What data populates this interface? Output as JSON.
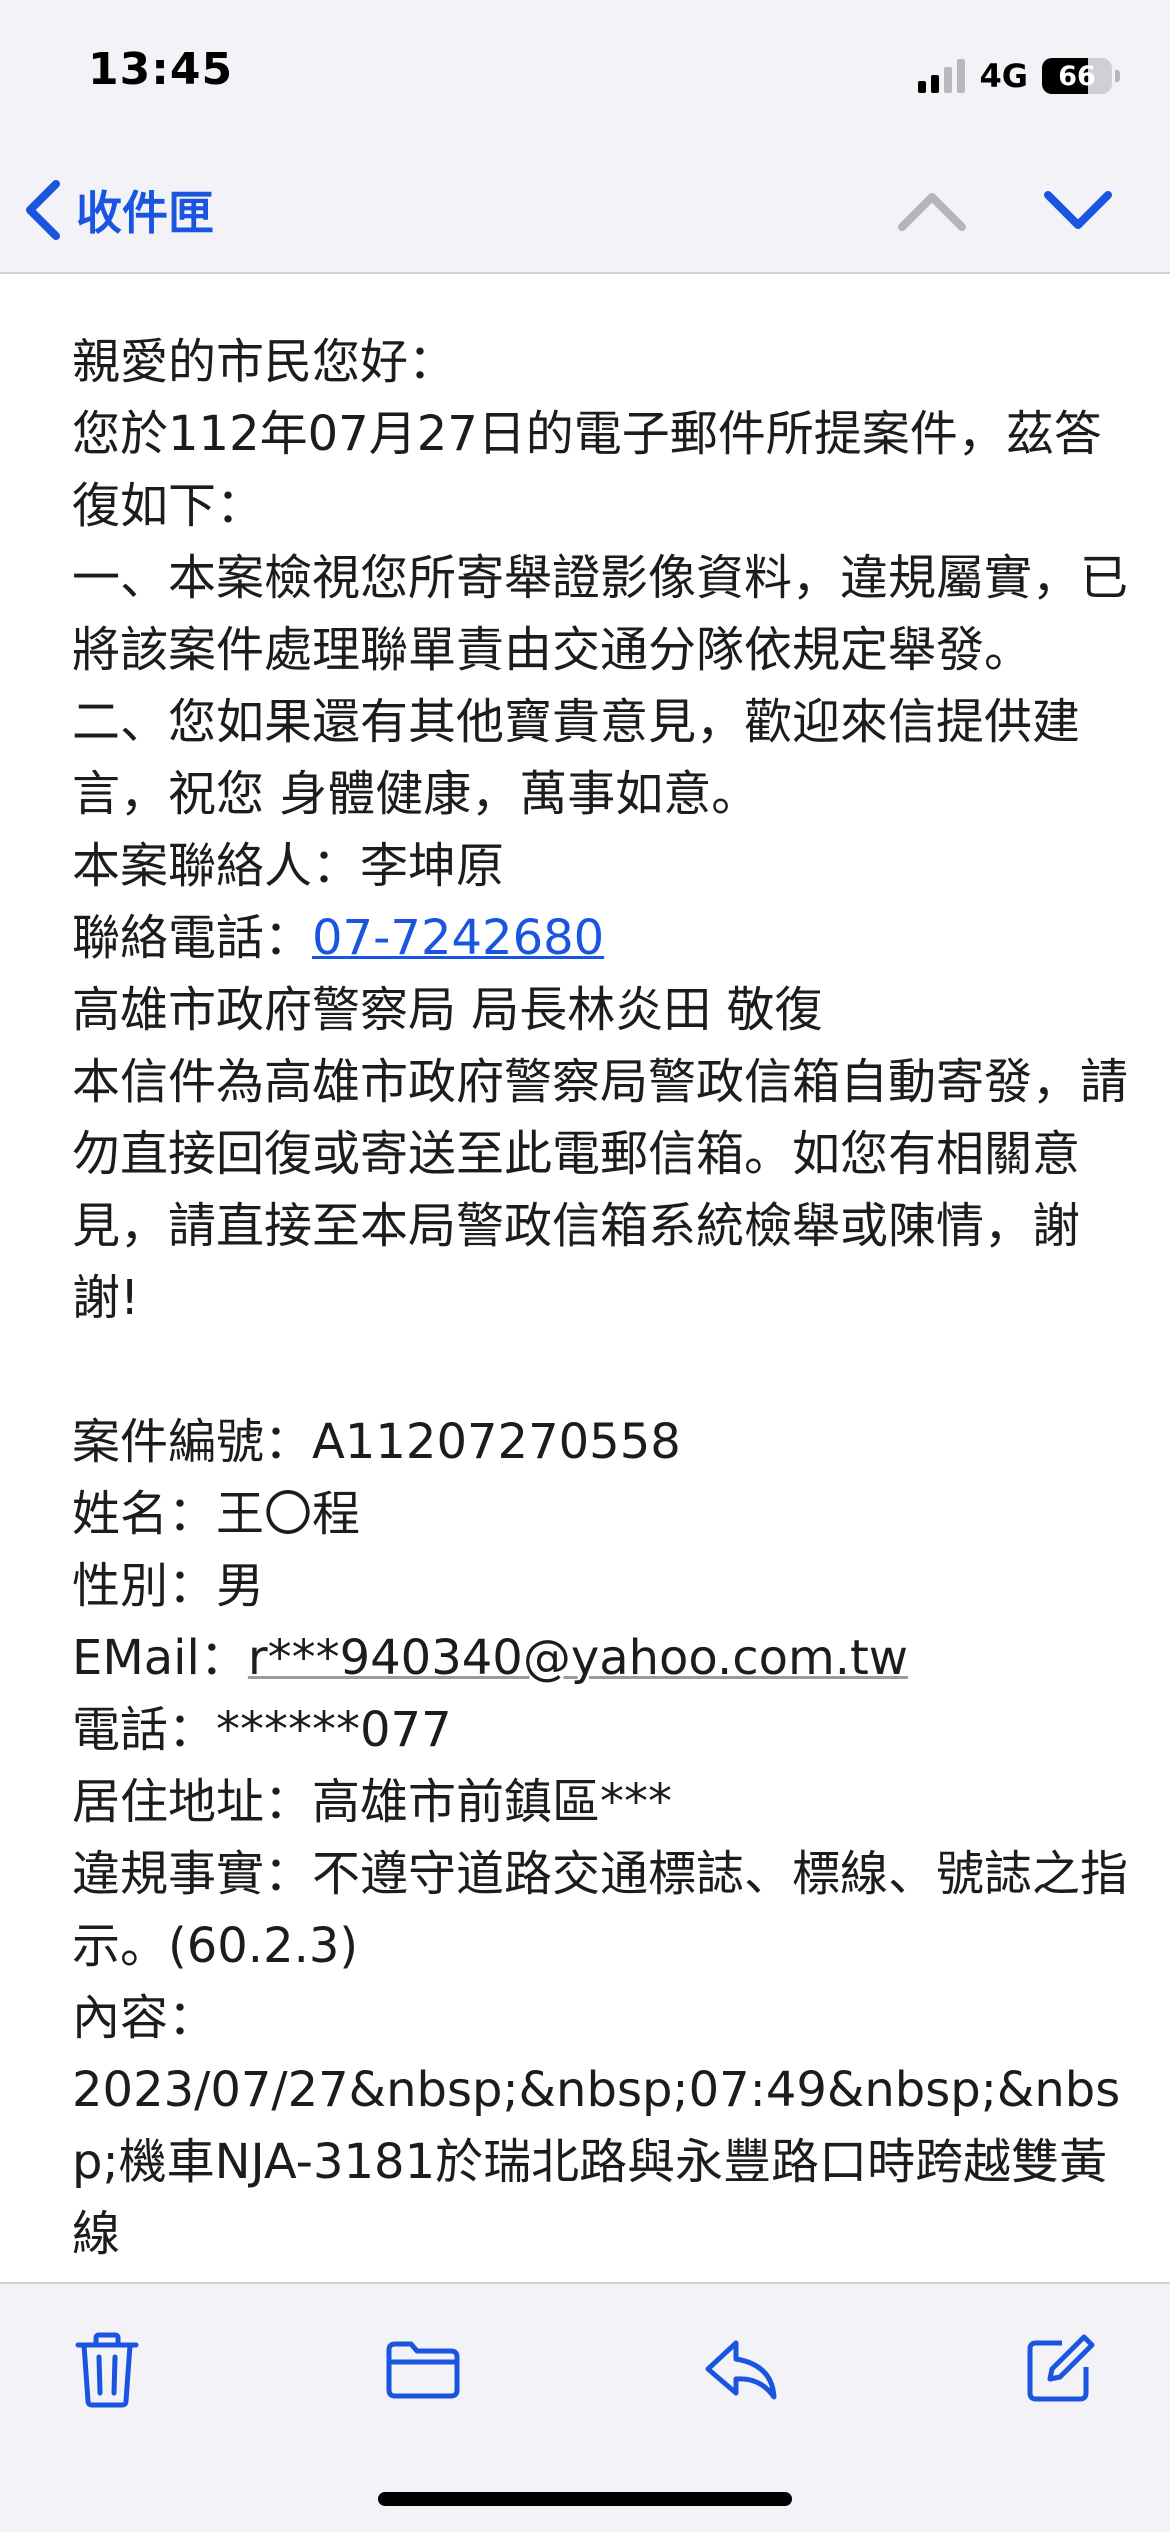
{
  "status_bar": {
    "time": "13:45",
    "network": "4G",
    "battery_percent": "66",
    "battery_level": 0.66,
    "signal_bars_active": 2,
    "signal_bars_total": 4
  },
  "nav": {
    "back_label": "收件匣",
    "back_icon": "chevron-left-icon",
    "prev_icon": "chevron-up-icon",
    "next_icon": "chevron-down-icon",
    "accent_color": "#1a55e0",
    "disabled_color": "#b4b4b9"
  },
  "message": {
    "greeting": "親愛的市民您好：",
    "intro": "您於112年07月27日的電子郵件所提案件，茲答復如下：",
    "point1": "一、本案檢視您所寄舉證影像資料，違規屬實，已將該案件處理聯單責由交通分隊依規定舉發。",
    "point2": "二、您如果還有其他寶貴意見，歡迎來信提供建言，祝您 身體健康，萬事如意。",
    "contact_person": "本案聯絡人：李坤原",
    "contact_phone_label": "聯絡電話：",
    "contact_phone": "07-7242680",
    "signature": "高雄市政府警察局 局長林炎田 敬復",
    "notice": "本信件為高雄市政府警察局警政信箱自動寄發，請勿直接回復或寄送至此電郵信箱。如您有相關意見，請直接至本局警政信箱系統檢舉或陳情，謝謝!",
    "case_number": "案件編號：A11207270558",
    "name": "姓名：王〇程",
    "gender": "性別：男",
    "email_label": "EMail：",
    "email": "r***940340@yahoo.com.tw",
    "phone": "電話：******077",
    "address": "居住地址：高雄市前鎮區***",
    "violation": "違規事實：不遵守道路交通標誌、標線、號誌之指示。(60.2.3)",
    "content_label": "內容：",
    "content": "2023/07/27&nbsp;&nbsp;07:49&nbsp;&nbsp;機車NJA-3181於瑞北路與永豐路口時跨越雙黃線"
  },
  "toolbar": {
    "trash_icon": "trash-icon",
    "folder_icon": "folder-icon",
    "reply_icon": "reply-icon",
    "compose_icon": "compose-icon"
  }
}
